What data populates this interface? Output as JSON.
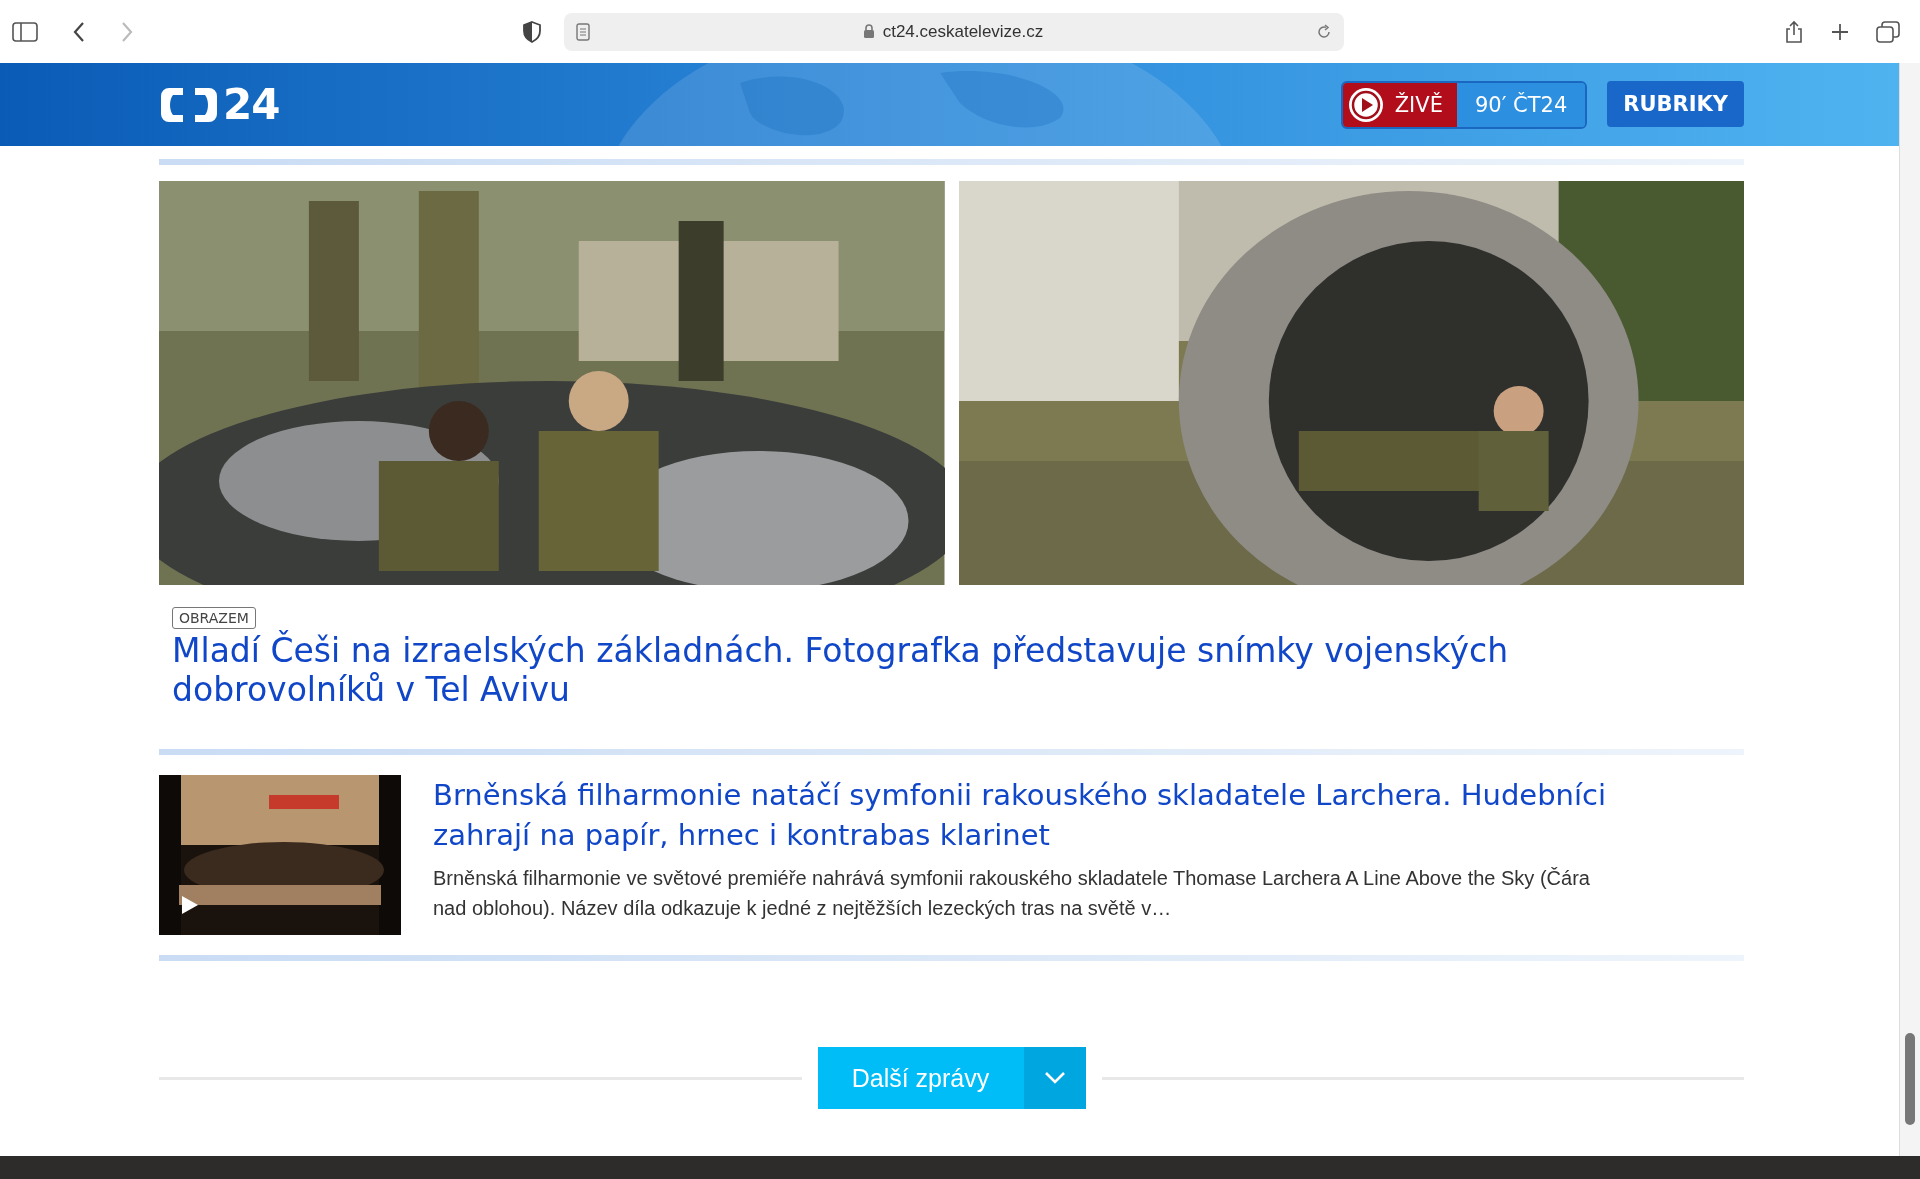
{
  "browser": {
    "url": "ct24.ceskatelevize.cz"
  },
  "header": {
    "logo_text": "24",
    "live_label": "ŽIVĚ",
    "channel_label": "90′ ČT24",
    "menu_label": "RUBRIKY"
  },
  "featured": {
    "tag": "OBRAZEM",
    "headline": "Mladí Češi na izraelských základnách. Fotografka představuje snímky vojenských dobrovolníků v Tel Avivu"
  },
  "articles": [
    {
      "title": "Brněnská filharmonie natáčí symfonii rakouského skladatele Larchera. Hudebníci zahrají na papír, hrnec i kontrabas klarinet",
      "summary": "Brněnská filharmonie ve světové premiéře nahrává symfonii rakouského skladatele Thomase Larchera A Line Above the Sky (Čára nad oblohou). Název díla odkazuje k jedné z nejtěžších lezeckých tras na světě v…",
      "video": true
    }
  ],
  "more_button": {
    "label": "Další zprávy"
  }
}
